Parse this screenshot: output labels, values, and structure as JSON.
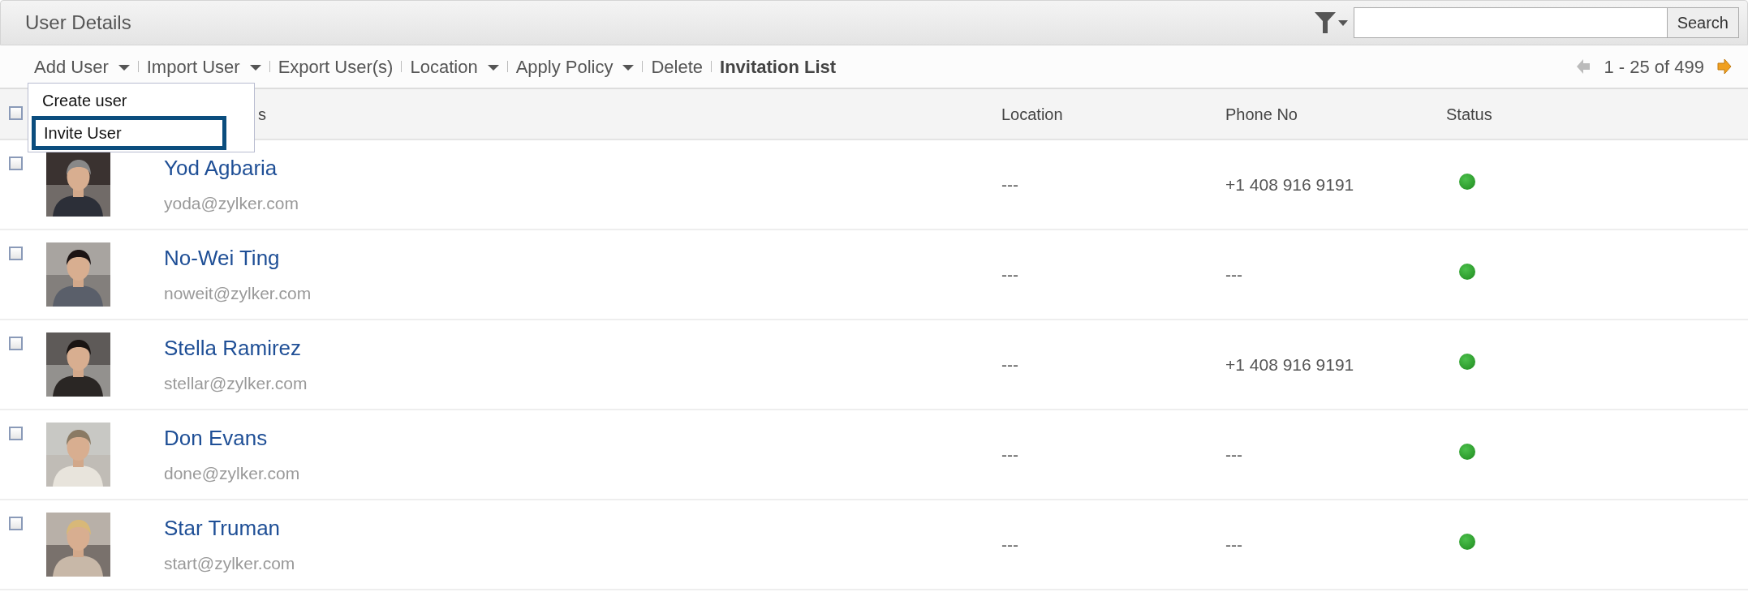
{
  "title": "User Details",
  "search": {
    "button": "Search"
  },
  "toolbar": [
    {
      "label": "Add User",
      "caret": true,
      "bold": false
    },
    {
      "label": "Import User",
      "caret": true,
      "bold": false
    },
    {
      "label": "Export User(s)",
      "caret": false,
      "bold": false
    },
    {
      "label": "Location",
      "caret": true,
      "bold": false
    },
    {
      "label": "Apply Policy",
      "caret": true,
      "bold": false
    },
    {
      "label": "Delete",
      "caret": false,
      "bold": false
    },
    {
      "label": "Invitation List",
      "caret": false,
      "bold": true
    }
  ],
  "pagination": "1 - 25 of 499",
  "menu": [
    {
      "label": "Create user",
      "selected": false
    },
    {
      "label": "Invite User",
      "selected": true
    }
  ],
  "table": {
    "select_all_checked": false,
    "columns": [
      "s",
      "Location",
      "Phone No",
      "Status"
    ],
    "rows": [
      {
        "checked": false,
        "name": "Yod Agbaria",
        "email": "yoda@zylker.com",
        "location": "---",
        "phone": "+1 408 916 9191",
        "active": true,
        "kind": "picture"
      },
      {
        "checked": false,
        "name": "No-Wei Ting",
        "email": "noweit@zylker.com",
        "location": "---",
        "phone": "---",
        "active": true,
        "kind": "picture"
      },
      {
        "checked": false,
        "name": "Stella Ramirez",
        "email": "stellar@zylker.com",
        "location": "---",
        "phone": "+1 408 916 9191",
        "active": true,
        "kind": "picture"
      },
      {
        "checked": false,
        "name": "Don Evans",
        "email": "done@zylker.com",
        "location": "---",
        "phone": "---",
        "active": true,
        "kind": "picture"
      },
      {
        "checked": false,
        "name": "Star Truman",
        "email": "start@zylker.com",
        "location": "---",
        "phone": "---",
        "active": true,
        "kind": "picture"
      }
    ]
  }
}
